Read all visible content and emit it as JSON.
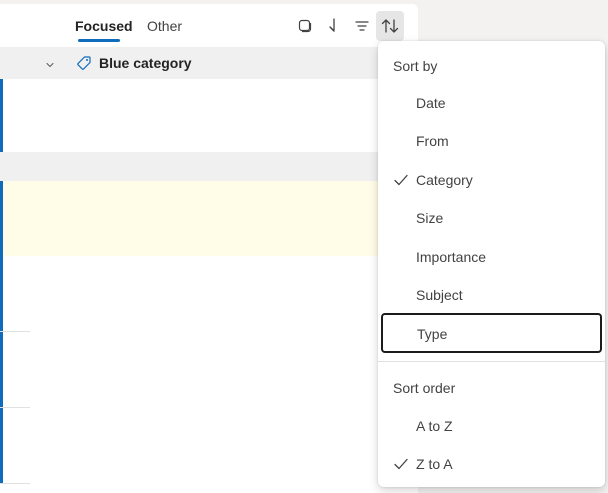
{
  "tabs": [
    {
      "label": "Focused",
      "selected": true
    },
    {
      "label": "Other",
      "selected": false
    }
  ],
  "group": {
    "label": "Blue category",
    "icon": "tag-icon"
  },
  "toolbar": {
    "icons": [
      "select-icon",
      "jump-to-icon",
      "filter-icon",
      "sort-icon"
    ]
  },
  "sort_menu": {
    "sort_by_header": "Sort by",
    "sort_by_items": [
      {
        "label": "Date",
        "checked": false
      },
      {
        "label": "From",
        "checked": false
      },
      {
        "label": "Category",
        "checked": true
      },
      {
        "label": "Size",
        "checked": false
      },
      {
        "label": "Importance",
        "checked": false
      },
      {
        "label": "Subject",
        "checked": false
      },
      {
        "label": "Type",
        "checked": false,
        "focused": true
      }
    ],
    "sort_order_header": "Sort order",
    "sort_order_items": [
      {
        "label": "A to Z",
        "checked": false
      },
      {
        "label": "Z to A",
        "checked": true
      }
    ]
  },
  "colors": {
    "accent": "#0f6cbd",
    "highlight_row": "#fffde7",
    "group_bar": "#f0f0f0"
  }
}
